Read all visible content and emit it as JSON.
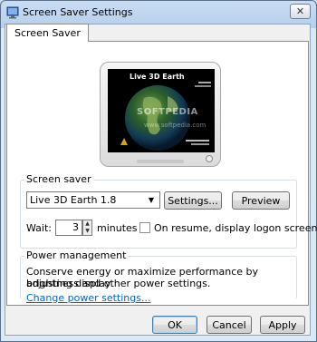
{
  "window": {
    "title": "Screen Saver Settings",
    "close_glyph": "✕"
  },
  "tabs": [
    {
      "label": "Screen Saver"
    }
  ],
  "preview": {
    "saver_title": "Live 3D Earth",
    "watermark": "SOFTPEDIA",
    "watermark_url": "www.softpedia.com"
  },
  "screensaver": {
    "group_label": "Screen saver",
    "selected": "Live 3D Earth 1.8",
    "settings_button": "Settings...",
    "preview_button": "Preview",
    "wait_label": "Wait:",
    "wait_value": "3",
    "minutes_label": "minutes",
    "resume_label": "On resume, display logon screen",
    "resume_checked": false
  },
  "power": {
    "group_label": "Power management",
    "description_line1": "Conserve energy or maximize performance by adjusting display",
    "description_line2": "brightness and other power settings.",
    "link": "Change power settings..."
  },
  "buttons": {
    "ok": "OK",
    "cancel": "Cancel",
    "apply": "Apply"
  }
}
